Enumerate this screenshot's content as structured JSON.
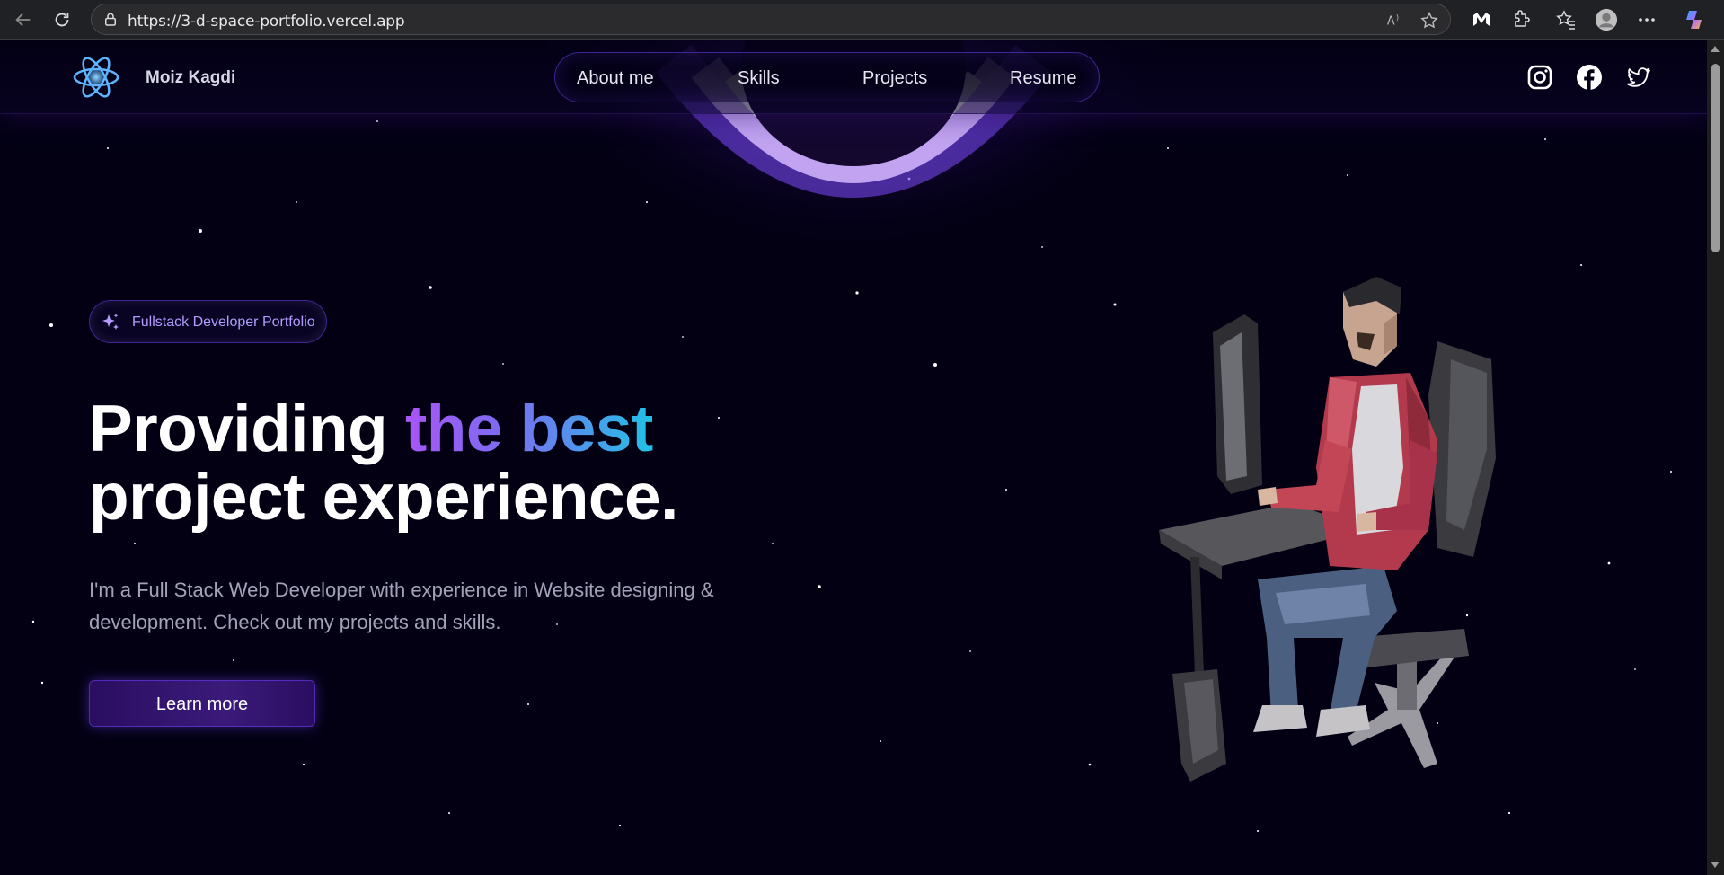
{
  "browser": {
    "url": "https://3-d-space-portfolio.vercel.app",
    "icons": [
      "back-icon",
      "reload-icon",
      "site-info-icon",
      "read-aloud-icon",
      "favorite-star-icon",
      "malwarebytes-icon",
      "extensions-icon",
      "favorites-icon",
      "profile-icon",
      "more-icon",
      "copilot-icon"
    ]
  },
  "site": {
    "brand": "Moiz Kagdi",
    "nav": [
      "About me",
      "Skills",
      "Projects",
      "Resume"
    ],
    "social": [
      "instagram-icon",
      "facebook-icon",
      "twitter-icon"
    ]
  },
  "hero": {
    "badge": "Fullstack Developer Portfolio",
    "headline_1": "Providing",
    "headline_highlight": "the best",
    "headline_2": "project experience.",
    "description": "I'm a Full Stack Web Developer with experience in Website designing & development. Check out my projects and skills.",
    "cta": "Learn more"
  },
  "colors": {
    "background": "#030014",
    "accent_purple": "#7042f8",
    "gradient_start": "#a855f7",
    "gradient_end": "#22c1e6",
    "button_bg": "#2a0e61"
  }
}
